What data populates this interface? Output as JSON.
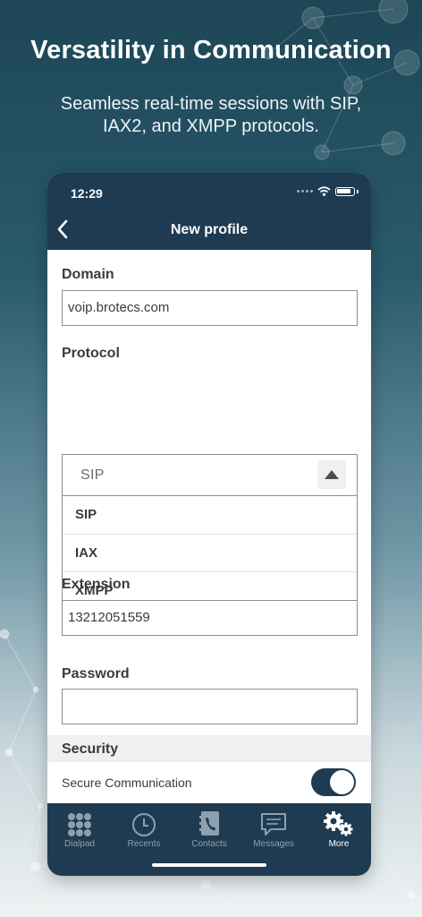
{
  "promo": {
    "headline": "Versatility in Communication",
    "subline": "Seamless real-time sessions with SIP, IAX2, and XMPP protocols."
  },
  "status_bar": {
    "time": "12:29"
  },
  "nav": {
    "title": "New profile",
    "back_icon": "chevron-left-icon"
  },
  "form": {
    "domain_label": "Domain",
    "domain_value": "voip.brotecs.com",
    "protocol_label": "Protocol",
    "protocol_selected": "SIP",
    "protocol_options": [
      "SIP",
      "IAX",
      "XMPP"
    ],
    "extension_label": "Extension",
    "extension_value": "13212051559",
    "password_label": "Password",
    "password_value": ""
  },
  "security": {
    "header": "Security",
    "secure_label": "Secure Communication",
    "secure_enabled": true
  },
  "tabs": [
    {
      "label": "Dialpad",
      "icon": "dialpad-icon",
      "active": false
    },
    {
      "label": "Recents",
      "icon": "clock-icon",
      "active": false
    },
    {
      "label": "Contacts",
      "icon": "contacts-icon",
      "active": false
    },
    {
      "label": "Messages",
      "icon": "message-icon",
      "active": false
    },
    {
      "label": "More",
      "icon": "gears-icon",
      "active": true
    }
  ],
  "colors": {
    "brand": "#1e3b52",
    "background_top": "#1d4656",
    "background_bottom": "#eef2f3"
  }
}
